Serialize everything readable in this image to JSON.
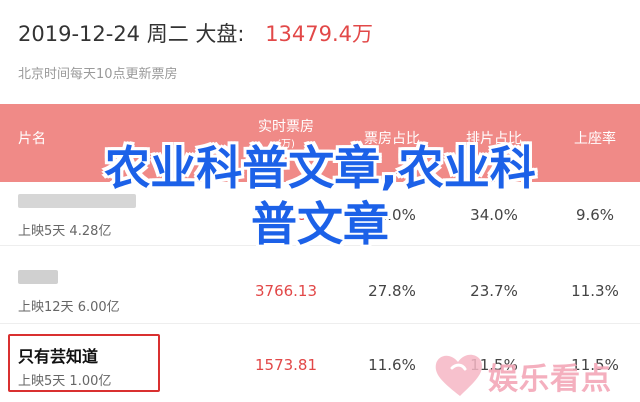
{
  "header": {
    "date": "2019-12-24",
    "weekday": "周二",
    "market_label": "大盘:",
    "total": "13479.4万",
    "time_note": "北京时间每天10点更新票房"
  },
  "columns": {
    "name": "片名",
    "realtime": "实时票房",
    "realtime_sort": "(万)",
    "share": "票房占比",
    "schedule": "排片占比",
    "seat": "上座率"
  },
  "rows": [
    {
      "release": "上映5天",
      "total": "4.28亿",
      "realtime": "5661.99",
      "share": "42.0%",
      "schedule": "34.0%",
      "seat": "9.6%"
    },
    {
      "release": "上映12天",
      "total": "6.00亿",
      "realtime": "3766.13",
      "share": "27.8%",
      "schedule": "23.7%",
      "seat": "11.3%"
    },
    {
      "name": "只有芸知道",
      "release": "上映5天",
      "total": "1.00亿",
      "realtime": "1573.81",
      "share": "11.6%",
      "schedule": "11.5%",
      "seat": "11.5%"
    }
  ],
  "overlay": {
    "line1": "农业科普文章,农业科",
    "line2": "普文章"
  },
  "watermark": "娱乐看点",
  "colors": {
    "header_bar": "#f08a87",
    "accent_red": "#e24848",
    "overlay_blue": "#1c61e8",
    "watermark_pink": "#f3a7b8"
  }
}
